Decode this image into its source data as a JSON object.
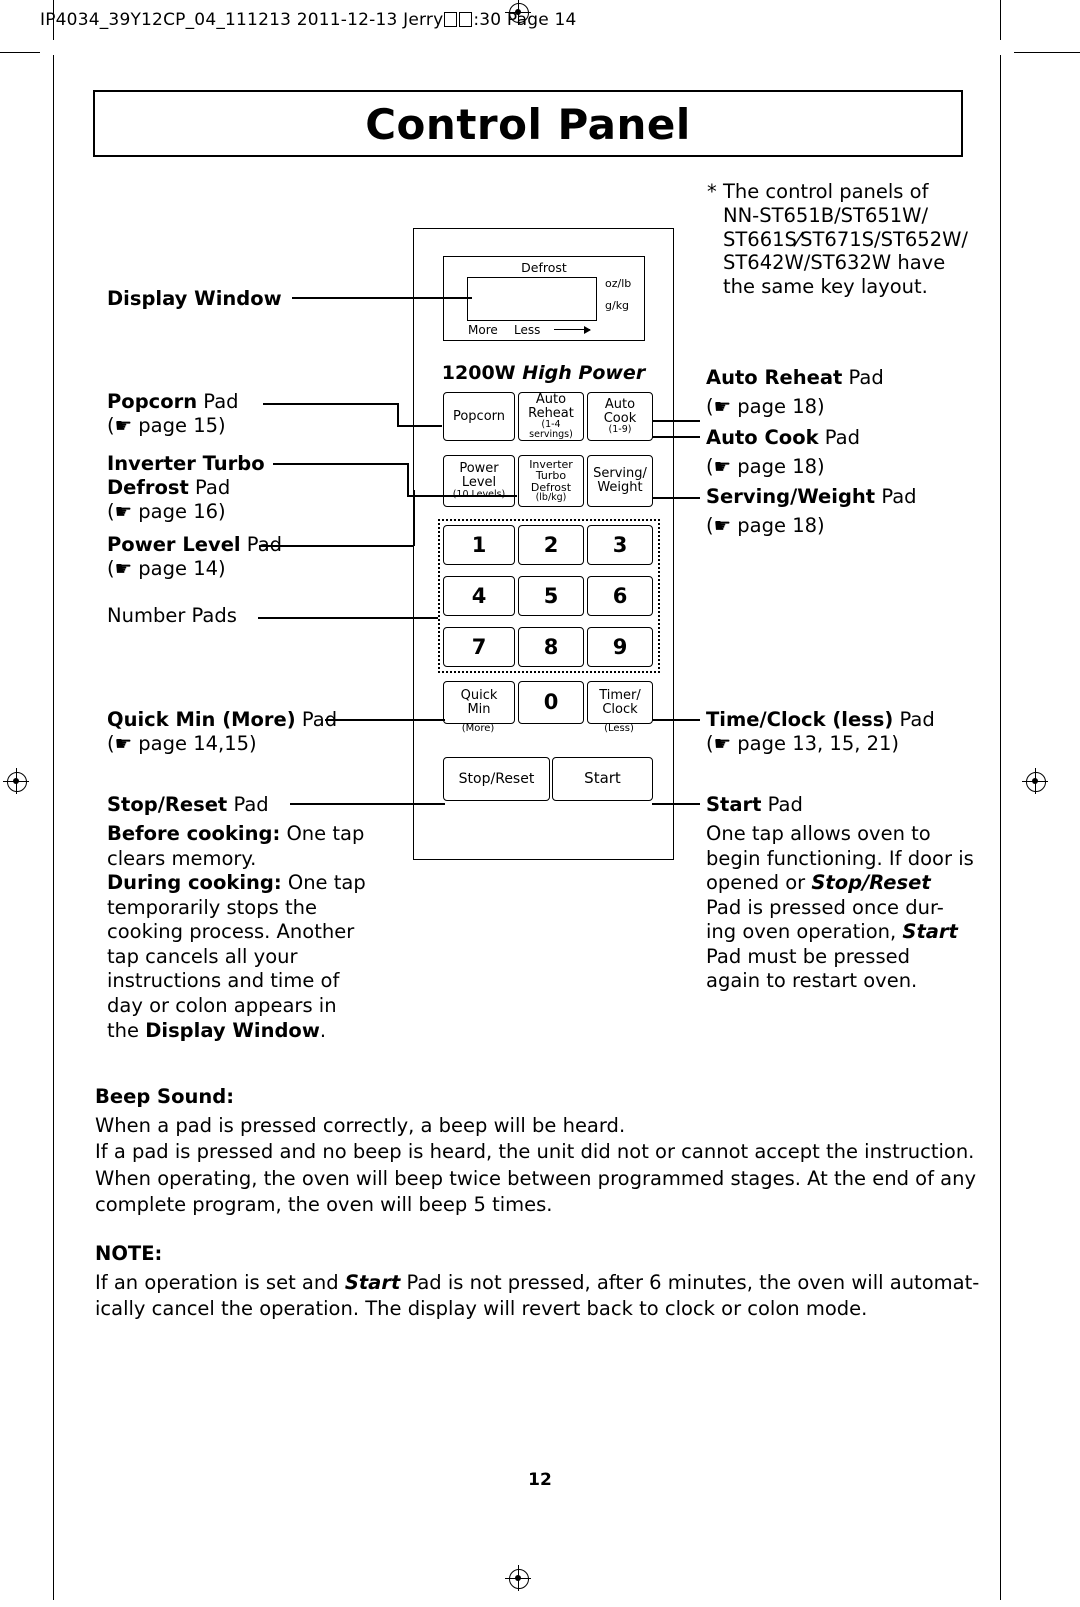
{
  "header": {
    "text_before": "IP4034_39Y12CP_04_111213  2011-12-13  Jerry",
    "text_after": ":30  Page 14"
  },
  "title": "Control Panel",
  "note_star": [
    "* The control panels of",
    "NN-ST651B/ST651W/",
    "ST661S⁄ST671S/ST652W/",
    "ST642W/ST632W have",
    "the same key layout."
  ],
  "panel": {
    "display": {
      "defrost_label": "Defrost",
      "oz_lb": "oz/lb",
      "g_kg": "g/kg",
      "more": "More",
      "less": "Less"
    },
    "high_power": {
      "watts": "1200W",
      "text": "High Power"
    },
    "keys": {
      "popcorn": "Popcorn",
      "auto_reheat_l1": "Auto",
      "auto_reheat_l2": "Reheat",
      "auto_reheat_sub": "(1-4 servings)",
      "auto_cook_l1": "Auto",
      "auto_cook_l2": "Cook",
      "auto_cook_sub": "(1-9)",
      "power_level_l1": "Power",
      "power_level_l2": "Level",
      "power_level_sub": "(10 Levels)",
      "inverter_l1": "Inverter",
      "inverter_l2": "Turbo",
      "inverter_l3": "Defrost",
      "inverter_sub": "(lb/kg)",
      "serving_l1": "Serving/",
      "serving_l2": "Weight",
      "numbers": [
        "1",
        "2",
        "3",
        "4",
        "5",
        "6",
        "7",
        "8",
        "9"
      ],
      "quick_min_l1": "Quick",
      "quick_min_l2": "Min",
      "quick_min_sub": "(More)",
      "zero": "0",
      "timer_l1": "Timer/",
      "timer_l2": "Clock",
      "timer_sub": "(Less)",
      "stop_reset": "Stop/Reset",
      "start": "Start"
    }
  },
  "left_callouts": {
    "display_window": "Display Window",
    "popcorn_name": "Popcorn",
    "popcorn_pad": " Pad",
    "popcorn_page": "page 15)",
    "inverter_l1": "Inverter Turbo",
    "inverter_l2": "Defrost",
    "inverter_pad": " Pad",
    "inverter_page": "page 16)",
    "power_name": "Power Level",
    "power_pad": " Pad",
    "power_page": "page 14)",
    "number_pads": "Number Pads",
    "quick_name": "Quick Min (More)",
    "quick_pad": " Pad",
    "quick_page": "page 14,15)",
    "stop_name": "Stop/Reset",
    "stop_pad": " Pad"
  },
  "right_callouts": {
    "auto_reheat_name": "Auto Reheat",
    "auto_reheat_pad": " Pad",
    "auto_reheat_page": "page 18)",
    "auto_cook_name": "Auto Cook",
    "auto_cook_pad": " Pad",
    "auto_cook_page": "page 18)",
    "serving_name": "Serving/Weight",
    "serving_pad": " Pad",
    "serving_page": "page 18)",
    "timeclock_name": "Time/Clock (less)",
    "timeclock_pad": " Pad",
    "timeclock_page": "page 13, 15, 21)",
    "start_name": "Start",
    "start_pad": " Pad"
  },
  "stop_reset_desc": {
    "before_label": "Before cooking:",
    "before_text": " One tap",
    "line2": "clears memory.",
    "during_label": "During cooking:",
    "during_text": " One tap",
    "line4": "temporarily stops the",
    "line5": "cooking process. Another",
    "line6": "tap cancels all your",
    "line7": "instructions and time of",
    "line8": "day or colon appears in",
    "line9_a": "the ",
    "line9_b": "Display Window",
    "line9_c": "."
  },
  "start_desc": {
    "line1": "One tap allows oven to",
    "line2": "begin functioning. If door is",
    "line3_a": "opened or ",
    "line3_b": "Stop/Reset",
    "line4": "Pad is pressed once dur-",
    "line5_a": "ing oven operation, ",
    "line5_b": "Start",
    "line6": "Pad must be pressed",
    "line7": "again to restart oven."
  },
  "beep": {
    "heading": "Beep Sound:",
    "line1": "When a pad is pressed correctly, a beep will be heard.",
    "line2": "If a pad is pressed and no beep is heard, the unit did not or cannot accept the instruction.",
    "line3": "When operating, the oven will beep twice between programmed stages. At the end of any",
    "line4": "complete program, the oven will beep 5 times."
  },
  "note": {
    "heading": "NOTE:",
    "line1_a": "If an operation is set and ",
    "line1_b": "Start",
    "line1_c": " Pad is not pressed, after 6 minutes, the oven will automat-",
    "line2": "ically cancel the operation. The display will revert back to clock or colon mode."
  },
  "page_number": "12"
}
